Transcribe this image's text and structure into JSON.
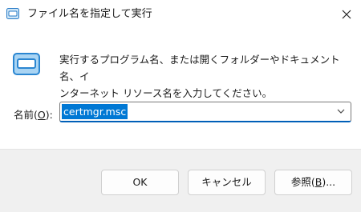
{
  "window": {
    "title": "ファイル名を指定して実行",
    "close_icon": "close-icon"
  },
  "content": {
    "icon": "run-icon",
    "description": "実行するプログラム名、または開くフォルダーやドキュメント名、イ\nンターネット リソース名を入力してください。",
    "name_label_pre": "名前(",
    "name_label_key": "O",
    "name_label_post": "):",
    "input_value": "certmgr.msc"
  },
  "buttons": {
    "ok": "OK",
    "cancel": "キャンセル",
    "browse_pre": "参照(",
    "browse_key": "B",
    "browse_post": ")..."
  },
  "colors": {
    "accent": "#0078d4",
    "focus_underline": "#005fb8"
  }
}
